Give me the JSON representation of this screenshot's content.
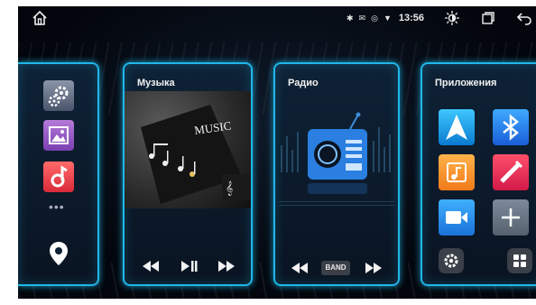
{
  "statusbar": {
    "time": "13:56",
    "icons": [
      "home-icon",
      "bluetooth-icon",
      "message-icon",
      "location-icon",
      "wifi-icon",
      "brightness-icon",
      "recent-apps-icon",
      "back-icon"
    ]
  },
  "cards": {
    "music": {
      "title": "Музыка",
      "art_text": "MUSIC",
      "controls": [
        "rewind-icon",
        "play-pause-icon",
        "fast-forward-icon"
      ]
    },
    "radio": {
      "title": "Радио",
      "band_label": "BAND",
      "controls": [
        "rewind-icon",
        "fast-forward-icon"
      ]
    },
    "apps": {
      "title": "Приложения",
      "tiles": [
        "navigation-icon",
        "bluetooth-icon",
        "music-player-icon",
        "aux-cable-icon",
        "video-icon",
        "add-icon"
      ]
    },
    "left": {
      "apps": [
        "settings-icon",
        "gallery-icon",
        "music-note-icon"
      ],
      "more": "•••"
    }
  },
  "colors": {
    "card_border": "#1fb7e8",
    "background": "#03060c"
  }
}
